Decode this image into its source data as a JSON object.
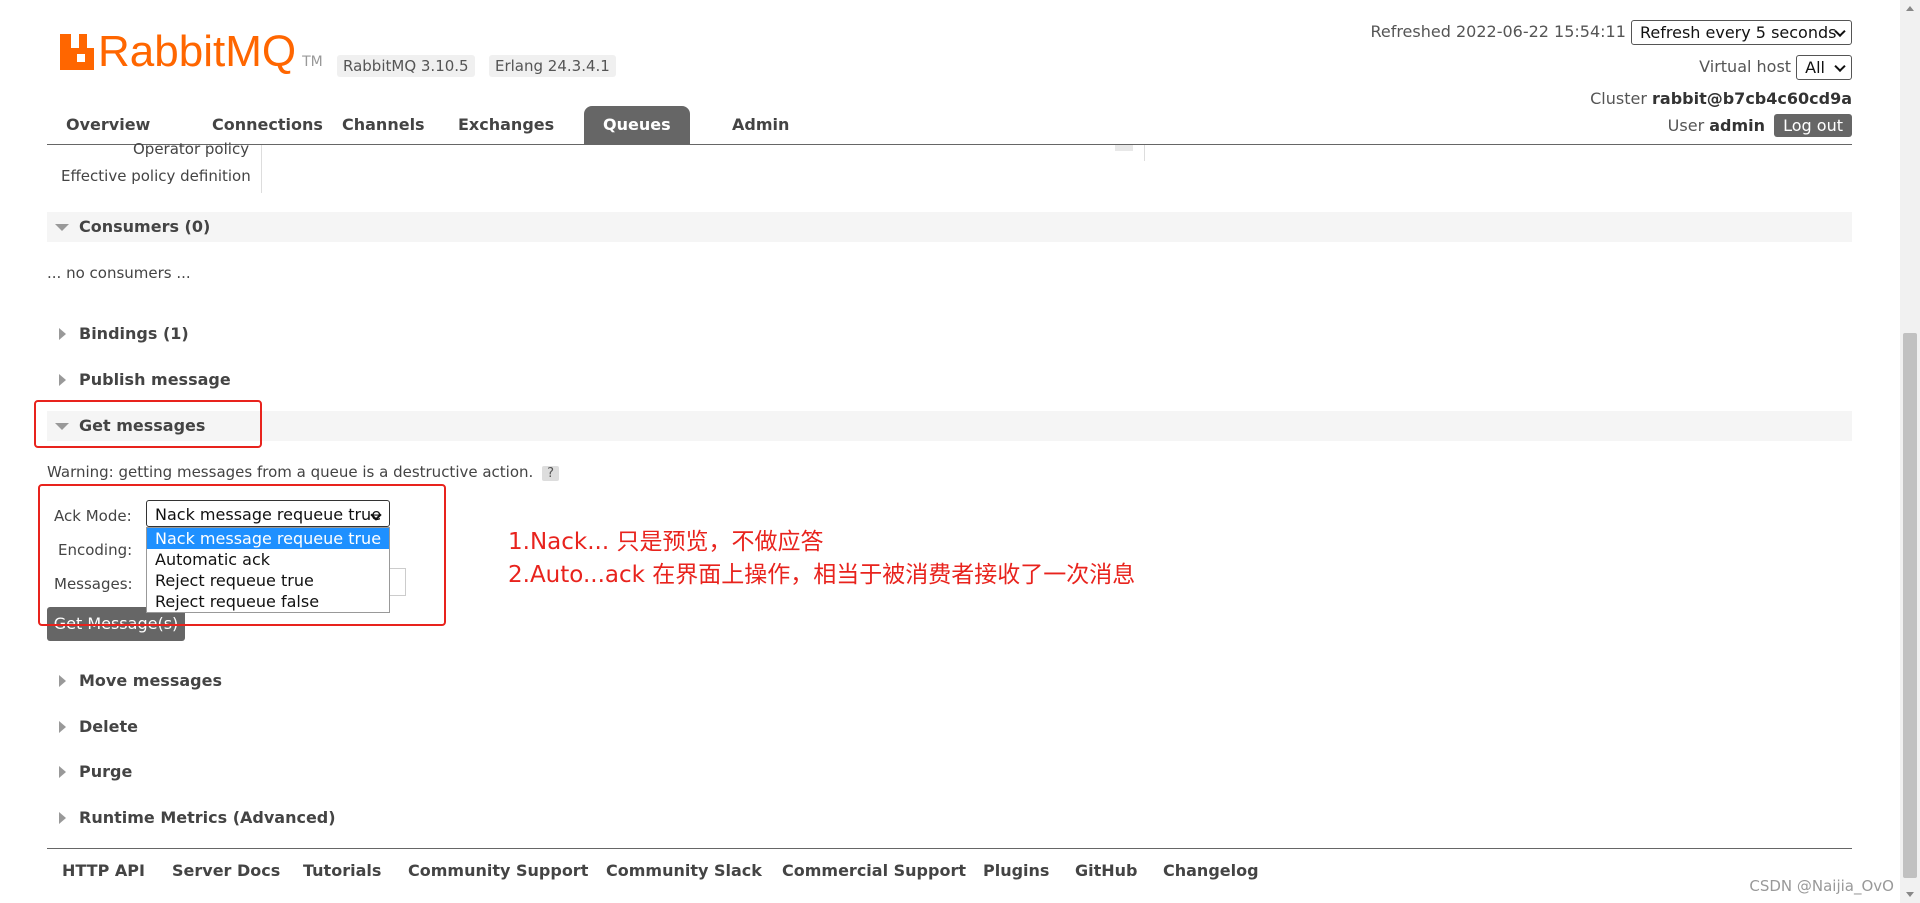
{
  "header": {
    "brand": "RabbitMQ",
    "tm": "TM",
    "rabbitmq_version": "RabbitMQ 3.10.5",
    "erlang_version": "Erlang 24.3.4.1",
    "refreshed_label": "Refreshed",
    "refreshed_time": "2022-06-22 15:54:11",
    "refresh_option": "Refresh every 5 seconds",
    "virtual_host_label": "Virtual host",
    "virtual_host_value": "All",
    "cluster_label": "Cluster",
    "cluster_value": "rabbit@b7cb4c60cd9a",
    "user_label": "User",
    "user_value": "admin",
    "logout_label": "Log out"
  },
  "nav": {
    "tabs": [
      {
        "label": "Overview",
        "active": false
      },
      {
        "label": "Connections",
        "active": false
      },
      {
        "label": "Channels",
        "active": false
      },
      {
        "label": "Exchanges",
        "active": false
      },
      {
        "label": "Queues",
        "active": true
      },
      {
        "label": "Admin",
        "active": false
      }
    ]
  },
  "policy": {
    "operator_policy_label": "Operator policy",
    "effective_policy_label": "Effective policy definition"
  },
  "sections": {
    "consumers": "Consumers (0)",
    "no_consumers": "... no consumers ...",
    "bindings": "Bindings (1)",
    "publish": "Publish message",
    "get_messages": "Get messages",
    "move": "Move messages",
    "delete": "Delete",
    "purge": "Purge",
    "runtime": "Runtime Metrics (Advanced)"
  },
  "get_messages": {
    "warning": "Warning: getting messages from a queue is a destructive action.",
    "help": "?",
    "ack_mode_label": "Ack Mode:",
    "encoding_label": "Encoding:",
    "messages_label": "Messages:",
    "ack_mode_value": "Nack message requeue true",
    "ack_options": [
      "Nack message requeue true",
      "Automatic ack",
      "Reject requeue true",
      "Reject requeue false"
    ],
    "button_label": "Get Message(s)"
  },
  "annotations": {
    "line1": "1.Nack... 只是预览，不做应答",
    "line2": "2.Auto...ack 在界面上操作，相当于被消费者接收了一次消息"
  },
  "footer": {
    "links": [
      "HTTP API",
      "Server Docs",
      "Tutorials",
      "Community Support",
      "Community Slack",
      "Commercial Support",
      "Plugins",
      "GitHub",
      "Changelog"
    ]
  },
  "watermark": "CSDN @Naijia_OvO",
  "colors": {
    "brand_orange": "#ff6600",
    "nav_active": "#666666",
    "annotation_red": "#e8231d",
    "dropdown_selected": "#1e90ff"
  }
}
